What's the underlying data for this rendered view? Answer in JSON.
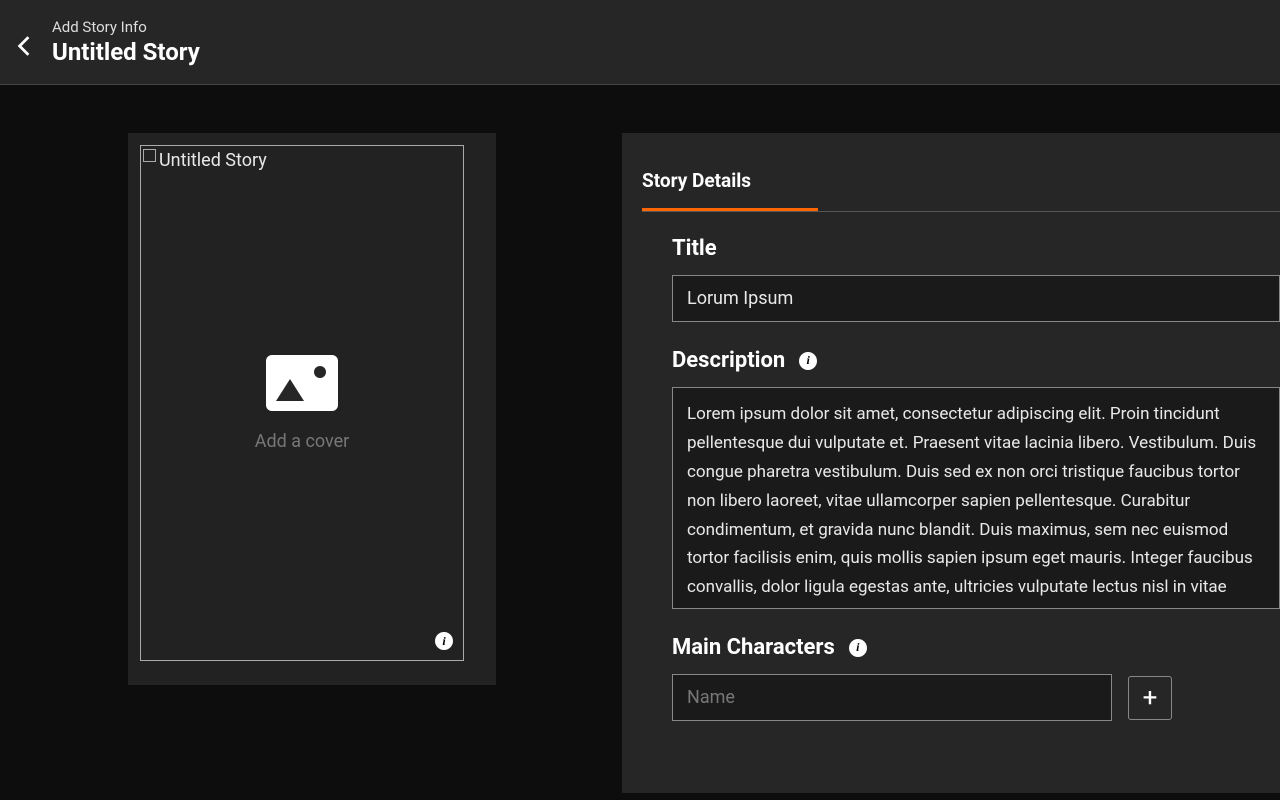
{
  "header": {
    "sub": "Add Story Info",
    "title": "Untitled Story"
  },
  "cover": {
    "label": "Untitled Story",
    "add_text": "Add a cover"
  },
  "details": {
    "tab_label": "Story Details",
    "title_label": "Title",
    "title_value": "Lorum Ipsum",
    "description_label": "Description",
    "description_value": "Lorem ipsum dolor sit amet, consectetur adipiscing elit. Proin tincidunt pellentesque dui vulputate et. Praesent vitae lacinia libero. Vestibulum. Duis congue pharetra vestibulum. Duis sed ex non orci tristique faucibus tortor non libero laoreet, vitae ullamcorper sapien pellentesque. Curabitur condimentum, et gravida nunc blandit. Duis maximus, sem nec euismod tortor facilisis enim, quis mollis sapien ipsum eget mauris. Integer faucibus convallis, dolor ligula egestas ante, ultricies vulputate lectus nisl in vitae augue eu, egestas tincidunt nibh. Fusce sapien felis, dictum vitae",
    "characters_label": "Main Characters",
    "character_placeholder": "Name",
    "add_button": "+"
  }
}
